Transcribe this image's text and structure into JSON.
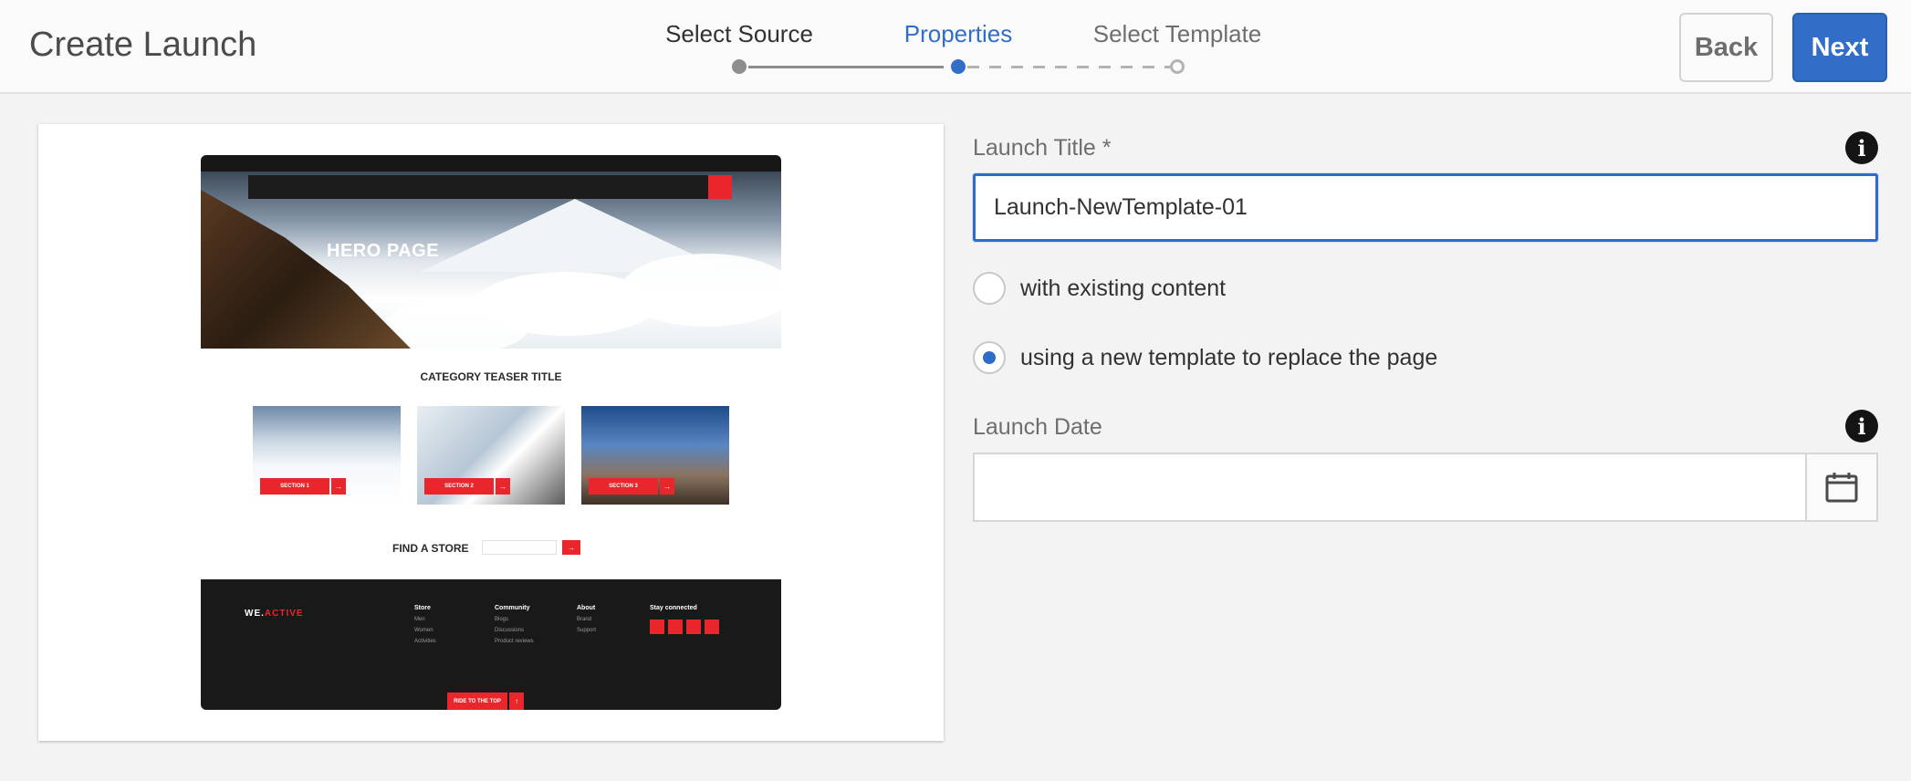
{
  "header": {
    "title": "Create Launch",
    "back_label": "Back",
    "next_label": "Next"
  },
  "wizard": {
    "steps": [
      {
        "label": "Select Source",
        "state": "done"
      },
      {
        "label": "Properties",
        "state": "active"
      },
      {
        "label": "Select Template",
        "state": "todo"
      }
    ]
  },
  "preview": {
    "hero_title": "HERO PAGE",
    "category_title": "CATEGORY TEASER TITLE",
    "sections": [
      "SECTION 1",
      "SECTION 2",
      "SECTION 3"
    ],
    "find_store_label": "FIND A STORE",
    "brand_we": "WE.",
    "brand_active": "ACTIVE",
    "footer_columns": [
      {
        "heading": "Store",
        "items": [
          "Men",
          "Women",
          "Activities"
        ]
      },
      {
        "heading": "Community",
        "items": [
          "Blogs",
          "Discussions",
          "Product reviews"
        ]
      },
      {
        "heading": "About",
        "items": [
          "Brand",
          "Support"
        ]
      },
      {
        "heading": "Stay connected",
        "items": []
      }
    ],
    "to_top_label": "RIDE TO THE TOP"
  },
  "form": {
    "launch_title_label": "Launch Title *",
    "launch_title_value": "Launch-NewTemplate-01",
    "option_existing": "with existing content",
    "option_new_template": "using a new template to replace the page",
    "selected_option": "new_template",
    "launch_date_label": "Launch Date",
    "launch_date_value": ""
  },
  "colors": {
    "accent": "#326ec8",
    "brand_red": "#e8262c"
  },
  "icons": {
    "info": "info-icon",
    "calendar": "calendar-icon"
  }
}
